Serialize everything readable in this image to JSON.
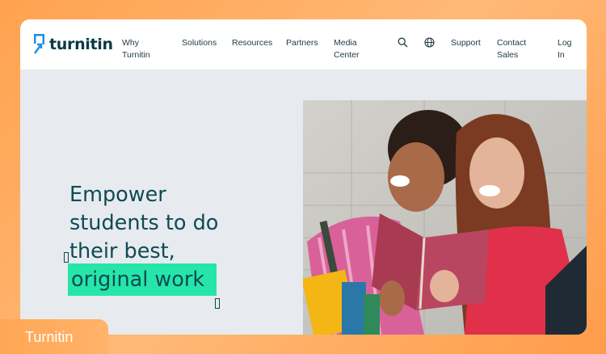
{
  "brand": {
    "logo_text": "turnitin"
  },
  "nav": {
    "why": [
      "Why",
      "Turnitin"
    ],
    "solutions": "Solutions",
    "resources": "Resources",
    "partners": "Partners",
    "media": [
      "Media",
      "Center"
    ],
    "support": "Support",
    "contact": [
      "Contact",
      "Sales"
    ],
    "login": [
      "Log",
      "In"
    ],
    "search_icon": "search-icon",
    "globe_icon": "globe-icon"
  },
  "hero": {
    "lines": [
      "Empower",
      "students to do",
      "their best,"
    ],
    "highlight": "original work",
    "highlight_color": "#25e6a8",
    "text_color": "#0d4b55"
  },
  "overlay": {
    "label": "Turnitin"
  },
  "colors": {
    "accent": "#25e6a8",
    "frame_bg": "#e7eaee",
    "orange": "#ffa24f"
  }
}
